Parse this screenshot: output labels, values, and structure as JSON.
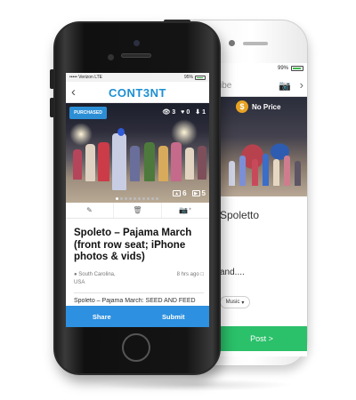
{
  "back_phone": {
    "status_battery": "99%",
    "nav_title_partial": "ibe",
    "price_label": "No Price",
    "price_coin": "$",
    "title_partial": "Spoletto",
    "text_partial": "and....",
    "category_pill": "Music",
    "post_button": "Post >",
    "colors": {
      "post": "#2bc06a",
      "coin": "#e8a323"
    }
  },
  "front_phone": {
    "status": {
      "carrier": "••••• Verizon",
      "network": "LTE",
      "battery": "95%"
    },
    "app": {
      "logo": "CONT3NT",
      "back_icon": "chevron-left-icon"
    },
    "post": {
      "badge": "PURCHASED",
      "views": "3",
      "likes": "0",
      "downloads": "1",
      "photo_count": "6",
      "video_count": "5",
      "title": "Spoleto – Pajama March (front row seat; iPhone photos & vids)",
      "location_line1": "South Carolina,",
      "location_line2": "USA",
      "time_ago": "8 hrs ago",
      "description": "Spoleto – Pajama March: SEED AND FEED"
    },
    "actions": {
      "share": "Share",
      "submit": "Submit"
    },
    "colors": {
      "brand": "#1d8fd2",
      "action_bar": "#2d90e0",
      "badge": "#2c8fd6"
    }
  }
}
